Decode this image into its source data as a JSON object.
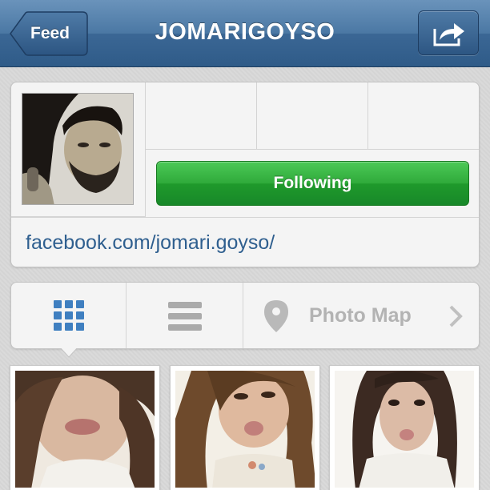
{
  "navbar": {
    "back_label": "Feed",
    "title": "JOMARIGOYSO",
    "share_icon": "share-arrow-icon"
  },
  "profile": {
    "following_label": "Following",
    "website": "facebook.com/jomari.goyso/"
  },
  "view_switcher": {
    "grid_icon": "grid-icon",
    "list_icon": "list-icon",
    "map_icon": "map-pin-icon",
    "map_label": "Photo Map",
    "chevron_icon": "chevron-right-icon"
  },
  "colors": {
    "navbar": "#3b6795",
    "following_green": "#2faa3a",
    "link": "#2f5f8f",
    "active_tab_blue": "#3f7fc0"
  }
}
